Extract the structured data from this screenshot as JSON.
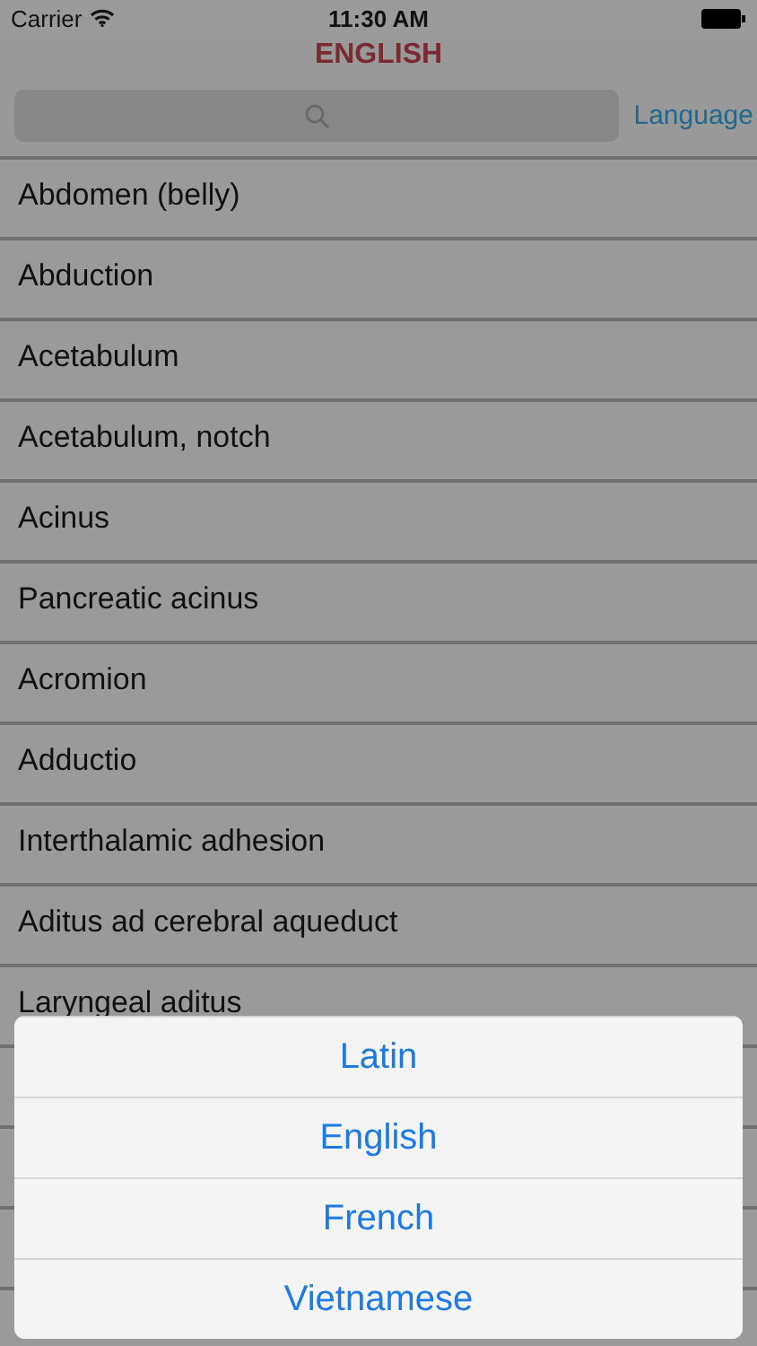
{
  "status_bar": {
    "carrier": "Carrier",
    "time": "11:30 AM"
  },
  "title": "ENGLISH",
  "language_button": "Language",
  "terms": [
    "Abdomen (belly)",
    "Abduction",
    "Acetabulum",
    "Acetabulum, notch",
    "Acinus",
    "Pancreatic acinus",
    "Acromion",
    "Adductio",
    "Interthalamic adhesion",
    "Aditus ad cerebral aqueduct",
    "Laryngeal aditus"
  ],
  "action_sheet": {
    "options": [
      "Latin",
      "English",
      "French",
      "Vietnamese"
    ]
  }
}
